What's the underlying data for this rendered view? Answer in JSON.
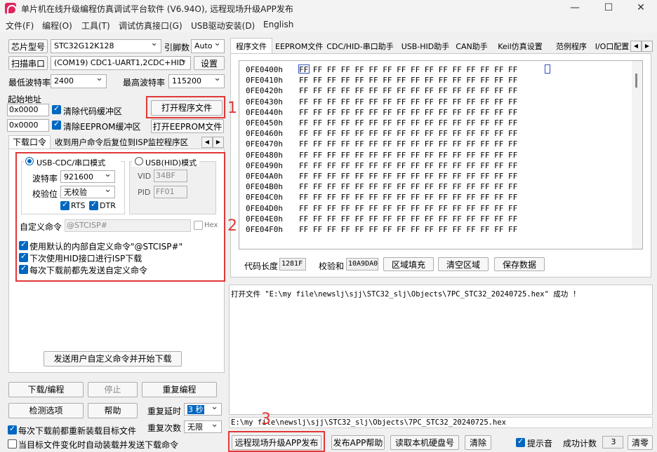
{
  "window": {
    "title": "单片机在线升级编程仿真调试平台软件 (V6.94O), 远程现场升级APP发布",
    "minimize": "—",
    "maximize": "☐",
    "close": "✕"
  },
  "menu": [
    "文件(F)",
    "编程(O)",
    "工具(T)",
    "调试仿真接口(G)",
    "USB驱动安装(D)",
    "English"
  ],
  "left": {
    "chip_label": "芯片型号",
    "chip_value": "STC32G12K128",
    "pins_label": "引脚数",
    "pins_value": "Auto",
    "scan_button": "扫描串口",
    "port_value": "(COM19) CDC1-UART1,2CDC+HID",
    "settings_button": "设置",
    "min_baud_label": "最低波特率",
    "min_baud_value": "2400",
    "max_baud_label": "最高波特率",
    "max_baud_value": "115200",
    "start_addr_label": "起始地址",
    "code_addr": "0x0000",
    "clear_code_label": "清除代码缓冲区",
    "open_program_button": "打开程序文件",
    "eeprom_addr": "0x0000",
    "clear_eeprom_label": "清除EEPROM缓冲区",
    "open_eeprom_button": "打开EEPROM文件",
    "tabs": [
      "下载口令",
      "收到用户命令后复位到ISP监控程序区"
    ],
    "usb_cdc_mode": "USB-CDC/串口模式",
    "usb_hid_mode": "USB(HID)模式",
    "baud_label": "波特率",
    "baud_value": "921600",
    "parity_label": "校验位",
    "parity_value": "无校验",
    "rts_label": "RTS",
    "dtr_label": "DTR",
    "vid_label": "VID",
    "vid_value": "34BF",
    "pid_label": "PID",
    "pid_value": "FF01",
    "custom_cmd_label": "自定义命令",
    "custom_cmd_value": "@STCISP#",
    "hex_label": "Hex",
    "opt1": "使用默认的内部自定义命令\"@STCISP#\"",
    "opt2": "下次使用HID接口进行ISP下载",
    "opt3": "每次下载前都先发送自定义命令",
    "send_button": "发送用户自定义命令并开始下载",
    "download_button": "下载/编程",
    "stop_button": "停止",
    "reprogram_button": "重复编程",
    "detect_button": "检测选项",
    "help_button": "帮助",
    "repeat_delay_label": "重复延时",
    "repeat_delay_value": "3 秒",
    "repeat_count_label": "重复次数",
    "repeat_count_value": "无限",
    "reload_label": "每次下载前都重新装载目标文件",
    "auto_label": "当目标文件变化时自动装载并发送下载命令"
  },
  "right": {
    "tabs": [
      "程序文件",
      "EEPROM文件",
      "CDC/HID-串口助手",
      "USB-HID助手",
      "CAN助手",
      "Keil仿真设置",
      "范例程序",
      "I/O口配置"
    ],
    "hex_rows": [
      {
        "addr": "0FE0400h",
        "bytes": "FF FF FF FF FF FF FF FF FF FF FF FF FF FF FF FF"
      },
      {
        "addr": "0FE0410h",
        "bytes": "FF FF FF FF FF FF FF FF FF FF FF FF FF FF FF FF"
      },
      {
        "addr": "0FE0420h",
        "bytes": "FF FF FF FF FF FF FF FF FF FF FF FF FF FF FF FF"
      },
      {
        "addr": "0FE0430h",
        "bytes": "FF FF FF FF FF FF FF FF FF FF FF FF FF FF FF FF"
      },
      {
        "addr": "0FE0440h",
        "bytes": "FF FF FF FF FF FF FF FF FF FF FF FF FF FF FF FF"
      },
      {
        "addr": "0FE0450h",
        "bytes": "FF FF FF FF FF FF FF FF FF FF FF FF FF FF FF FF"
      },
      {
        "addr": "0FE0460h",
        "bytes": "FF FF FF FF FF FF FF FF FF FF FF FF FF FF FF FF"
      },
      {
        "addr": "0FE0470h",
        "bytes": "FF FF FF FF FF FF FF FF FF FF FF FF FF FF FF FF"
      },
      {
        "addr": "0FE0480h",
        "bytes": "FF FF FF FF FF FF FF FF FF FF FF FF FF FF FF FF"
      },
      {
        "addr": "0FE0490h",
        "bytes": "FF FF FF FF FF FF FF FF FF FF FF FF FF FF FF FF"
      },
      {
        "addr": "0FE04A0h",
        "bytes": "FF FF FF FF FF FF FF FF FF FF FF FF FF FF FF FF"
      },
      {
        "addr": "0FE04B0h",
        "bytes": "FF FF FF FF FF FF FF FF FF FF FF FF FF FF FF FF"
      },
      {
        "addr": "0FE04C0h",
        "bytes": "FF FF FF FF FF FF FF FF FF FF FF FF FF FF FF FF"
      },
      {
        "addr": "0FE04D0h",
        "bytes": "FF FF FF FF FF FF FF FF FF FF FF FF FF FF FF FF"
      },
      {
        "addr": "0FE04E0h",
        "bytes": "FF FF FF FF FF FF FF FF FF FF FF FF FF FF FF FF"
      },
      {
        "addr": "0FE04F0h",
        "bytes": "FF FF FF FF FF FF FF FF FF FF FF FF FF FF FF FF"
      }
    ],
    "code_len_label": "代码长度",
    "code_len_value": "1281F",
    "checksum_label": "校验和",
    "checksum_value": "10A9DA0",
    "fill_button": "区域填充",
    "clear_button": "清空区域",
    "save_button": "保存数据",
    "log_text": "打开文件 \"E:\\my file\\newslj\\sjj\\STC32_slj\\Objects\\7PC_STC32_20240725.hex\" 成功 !",
    "path_text": "E:\\my file\\newslj\\sjj\\STC32_slj\\Objects\\7PC_STC32_20240725.hex",
    "publish_button": "远程现场升级APP发布",
    "publish_help_button": "发布APP帮助",
    "read_disk_button": "读取本机硬盘号",
    "clear_log_button": "清除",
    "sound_label": "提示音",
    "success_label": "成功计数",
    "success_value": "3",
    "reset_count_button": "清零"
  },
  "annotations": [
    "1",
    "2",
    "3"
  ]
}
